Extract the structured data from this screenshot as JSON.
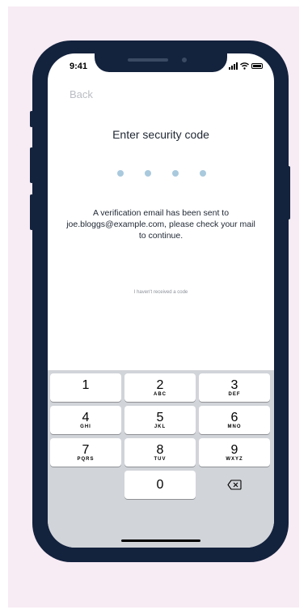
{
  "status_bar": {
    "time": "9:41"
  },
  "nav": {
    "back_label": "Back"
  },
  "screen": {
    "title": "Enter security code",
    "message": "A verification email has been sent to joe.bloggs@example.com, please check your mail to continue.",
    "resend_link": "I haven't received a code",
    "code_digits_entered": 0,
    "code_length": 4
  },
  "keypad": {
    "rows": [
      [
        {
          "digit": "1",
          "letters": ""
        },
        {
          "digit": "2",
          "letters": "ABC"
        },
        {
          "digit": "3",
          "letters": "DEF"
        }
      ],
      [
        {
          "digit": "4",
          "letters": "GHI"
        },
        {
          "digit": "5",
          "letters": "JKL"
        },
        {
          "digit": "6",
          "letters": "MNO"
        }
      ],
      [
        {
          "digit": "7",
          "letters": "PQRS"
        },
        {
          "digit": "8",
          "letters": "TUV"
        },
        {
          "digit": "9",
          "letters": "WXYZ"
        }
      ]
    ],
    "zero": {
      "digit": "0",
      "letters": ""
    },
    "delete_icon": "backspace-icon"
  },
  "colors": {
    "background": "#f7ebf4",
    "device": "#13223d",
    "code_dot": "#a9c9dd",
    "keypad_bg": "#d1d4d9",
    "back_text": "#b9bcc2"
  }
}
